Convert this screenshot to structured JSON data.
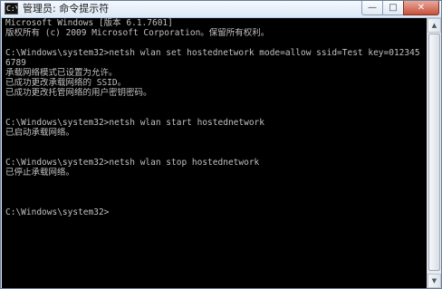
{
  "window": {
    "title": "管理员: 命令提示符",
    "icon_text": "C:\\",
    "controls": {
      "minimize": "—",
      "maximize": "□",
      "close": "✕"
    }
  },
  "console": {
    "lines": [
      "Microsoft Windows [版本 6.1.7601]",
      "版权所有 (c) 2009 Microsoft Corporation。保留所有权利。",
      "",
      "C:\\Windows\\system32>netsh wlan set hostednetwork mode=allow ssid=Test key=012345",
      "6789",
      "承载网络模式已设置为允许。",
      "已成功更改承载网络的 SSID。",
      "已成功更改托管网络的用户密钥密码。",
      "",
      "",
      "C:\\Windows\\system32>netsh wlan start hostednetwork",
      "已启动承载网络。",
      "",
      "",
      "C:\\Windows\\system32>netsh wlan stop hostednetwork",
      "已停止承载网络。",
      "",
      "",
      "",
      "C:\\Windows\\system32>"
    ]
  },
  "scrollbar": {
    "up_arrow": "▲",
    "down_arrow": "▼"
  }
}
